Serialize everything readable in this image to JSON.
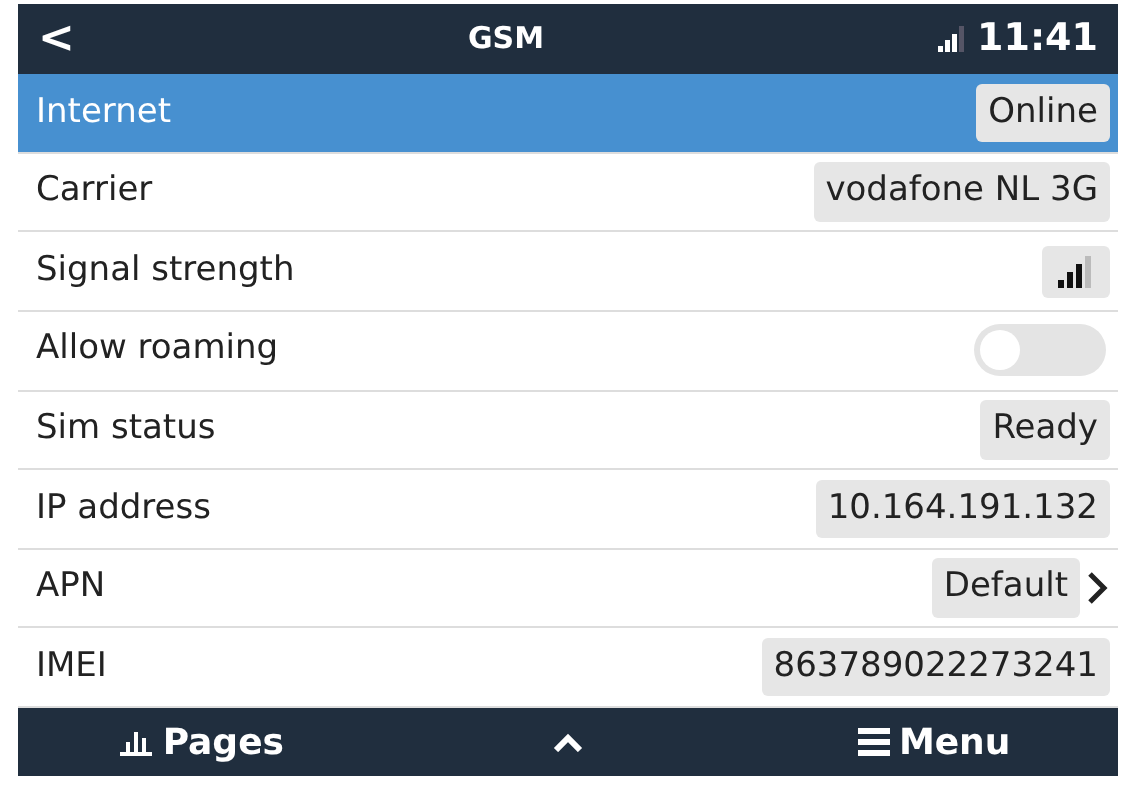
{
  "header": {
    "back": "<",
    "title": "GSM",
    "time": "11:41"
  },
  "rows": [
    {
      "kind": "value",
      "label": "Internet",
      "value": "Online",
      "selected": true
    },
    {
      "kind": "value",
      "label": "Carrier",
      "value": "vodafone NL 3G",
      "selected": false
    },
    {
      "kind": "signal",
      "label": "Signal strength",
      "selected": false
    },
    {
      "kind": "toggle",
      "label": "Allow roaming",
      "on": false,
      "selected": false
    },
    {
      "kind": "value",
      "label": "Sim status",
      "value": "Ready",
      "selected": false
    },
    {
      "kind": "value",
      "label": "IP address",
      "value": "10.164.191.132",
      "selected": false
    },
    {
      "kind": "link",
      "label": "APN",
      "value": "Default",
      "selected": false
    },
    {
      "kind": "value",
      "label": "IMEI",
      "value": "863789022273241",
      "selected": false
    }
  ],
  "footer": {
    "pages": "Pages",
    "menu": "Menu"
  }
}
